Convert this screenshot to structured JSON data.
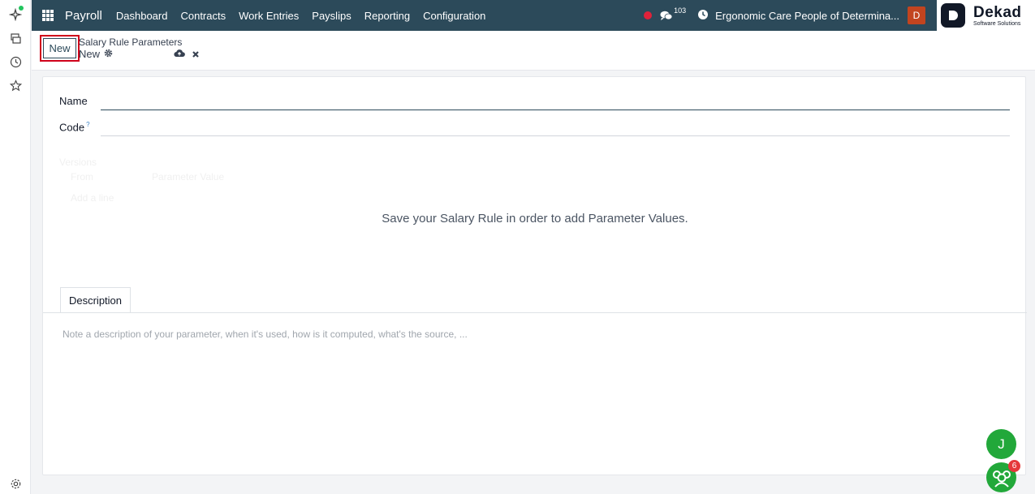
{
  "navbar": {
    "app_name": "Payroll",
    "menu": [
      "Dashboard",
      "Contracts",
      "Work Entries",
      "Payslips",
      "Reporting",
      "Configuration"
    ],
    "chat_count": "103",
    "company": "Ergonomic Care People of Determina...",
    "user_initial": "D",
    "logo_title": "Dekad",
    "logo_subtitle": "Software Solutions"
  },
  "control": {
    "new_label": "New",
    "breadcrumb": "Salary Rule Parameters",
    "record_name": "New"
  },
  "form": {
    "name_label": "Name",
    "code_label": "Code",
    "code_help": "?",
    "versions_label": "Versions",
    "col_from": "From",
    "col_value": "Parameter Value",
    "add_line": "Add a line",
    "save_message": "Save your Salary Rule in order to add Parameter Values.",
    "tab_description": "Description",
    "description_placeholder": "Note a description of your parameter, when it's used, how is it computed, what's the source, ..."
  },
  "floating": {
    "user_bubble": "J",
    "notif_count": "6"
  },
  "colors": {
    "navbar": "#2c4a5a",
    "highlight": "#d0021b",
    "bubble": "#22a83a",
    "user_avatar": "#c2441f"
  }
}
